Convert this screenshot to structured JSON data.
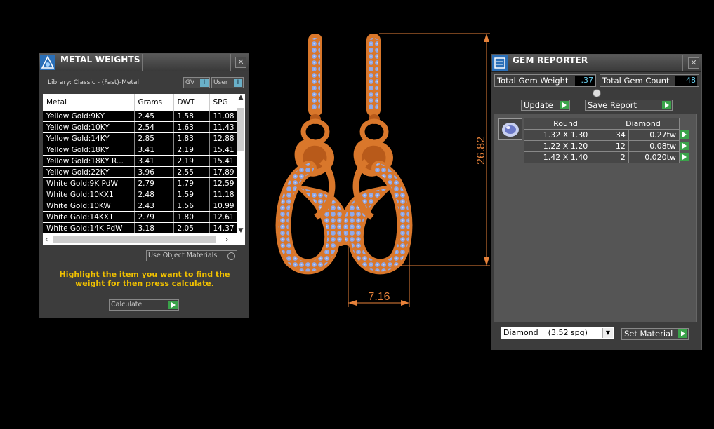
{
  "metal_weights": {
    "title": "METAL WEIGHTS",
    "library": "Library: Classic - (Fast)-Metal",
    "gv_label": "GV",
    "user_label": "User",
    "columns": [
      "Metal",
      "Grams",
      "DWT",
      "SPG"
    ],
    "rows": [
      [
        "Yellow Gold:9KY",
        "2.45",
        "1.58",
        "11.08"
      ],
      [
        "Yellow Gold:10KY",
        "2.54",
        "1.63",
        "11.43"
      ],
      [
        "Yellow Gold:14KY",
        "2.85",
        "1.83",
        "12.88"
      ],
      [
        "Yellow Gold:18KY",
        "3.41",
        "2.19",
        "15.41"
      ],
      [
        "Yellow Gold:18KY R...",
        "3.41",
        "2.19",
        "15.41"
      ],
      [
        "Yellow Gold:22KY",
        "3.96",
        "2.55",
        "17.89"
      ],
      [
        "White Gold:9K PdW",
        "2.79",
        "1.79",
        "12.59"
      ],
      [
        "White Gold:10KX1",
        "2.48",
        "1.59",
        "11.18"
      ],
      [
        "White Gold:10KW",
        "2.43",
        "1.56",
        "10.99"
      ],
      [
        "White Gold:14KX1",
        "2.79",
        "1.80",
        "12.61"
      ],
      [
        "White Gold:14K PdW",
        "3.18",
        "2.05",
        "14.37"
      ]
    ],
    "use_object_materials": "Use Object Materials",
    "hint": "Highlight the item you want to find the weight for then press calculate.",
    "calculate": "Calculate"
  },
  "gem_reporter": {
    "title": "GEM REPORTER",
    "total_weight_label": "Total Gem Weight",
    "total_weight": ".37",
    "total_count_label": "Total Gem Count",
    "total_count": "48",
    "update": "Update",
    "save_report": "Save Report",
    "header": [
      "Round",
      "Diamond"
    ],
    "rows": [
      [
        "1.32 X 1.30",
        "34",
        "0.27tw"
      ],
      [
        "1.22 X 1.20",
        "12",
        "0.08tw"
      ],
      [
        "1.42 X 1.40",
        "2",
        "0.020tw"
      ]
    ],
    "material": "Diamond    (3.52 spg)",
    "set_material": "Set Material"
  },
  "dimensions": {
    "height": "26.82",
    "width": "7.16"
  },
  "colors": {
    "metal": "#d9772b",
    "gem": "#8fa8e8",
    "dimension": "#e8823a",
    "hint": "#f0c000"
  }
}
